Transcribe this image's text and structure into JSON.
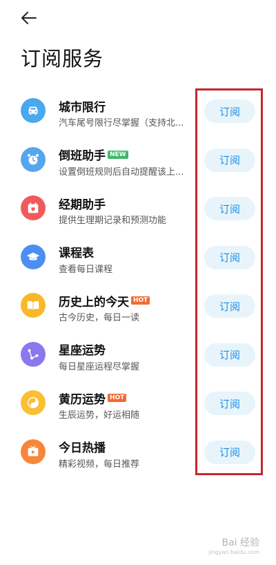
{
  "header": {
    "back_icon": "arrow-left-icon",
    "title": "订阅服务"
  },
  "subscribe_label": "订阅",
  "colors": {
    "button_bg": "#e8f4fb",
    "button_text": "#1f8ee6",
    "highlight_border": "#c4262e",
    "badge_new": "#3fb86a",
    "badge_hot": "#f06a31"
  },
  "services": [
    {
      "title": "城市限行",
      "subtitle": "汽车尾号限行尽掌握（支持北...",
      "icon": "car-icon",
      "icon_color": "#4aa8ef",
      "badge": ""
    },
    {
      "title": "倒班助手",
      "subtitle": "设置倒班规则后自动提醒该上...",
      "icon": "alarm-clock-icon",
      "icon_color": "#56a6ee",
      "badge": "NEW"
    },
    {
      "title": "经期助手",
      "subtitle": "提供生理期记录和预测功能",
      "icon": "calendar-heart-icon",
      "icon_color": "#f15a5a",
      "badge": ""
    },
    {
      "title": "课程表",
      "subtitle": "查看每日课程",
      "icon": "graduation-cap-icon",
      "icon_color": "#4d8ff0",
      "badge": ""
    },
    {
      "title": "历史上的今天",
      "subtitle": "古今历史，每日一读",
      "icon": "open-book-icon",
      "icon_color": "#f8b82a",
      "badge": "HOT"
    },
    {
      "title": "星座运势",
      "subtitle": "每日星座运程尽掌握",
      "icon": "constellation-icon",
      "icon_color": "#8b78ee",
      "badge": ""
    },
    {
      "title": "黄历运势",
      "subtitle": "生辰运势，好运相随",
      "icon": "yin-yang-icon",
      "icon_color": "#f8c032",
      "badge": "HOT"
    },
    {
      "title": "今日热播",
      "subtitle": "精彩视频，每日推荐",
      "icon": "video-play-icon",
      "icon_color": "#f7863a",
      "badge": ""
    }
  ],
  "watermark": {
    "text": "Bai 经验",
    "url": "jingyan.baidu.com"
  }
}
